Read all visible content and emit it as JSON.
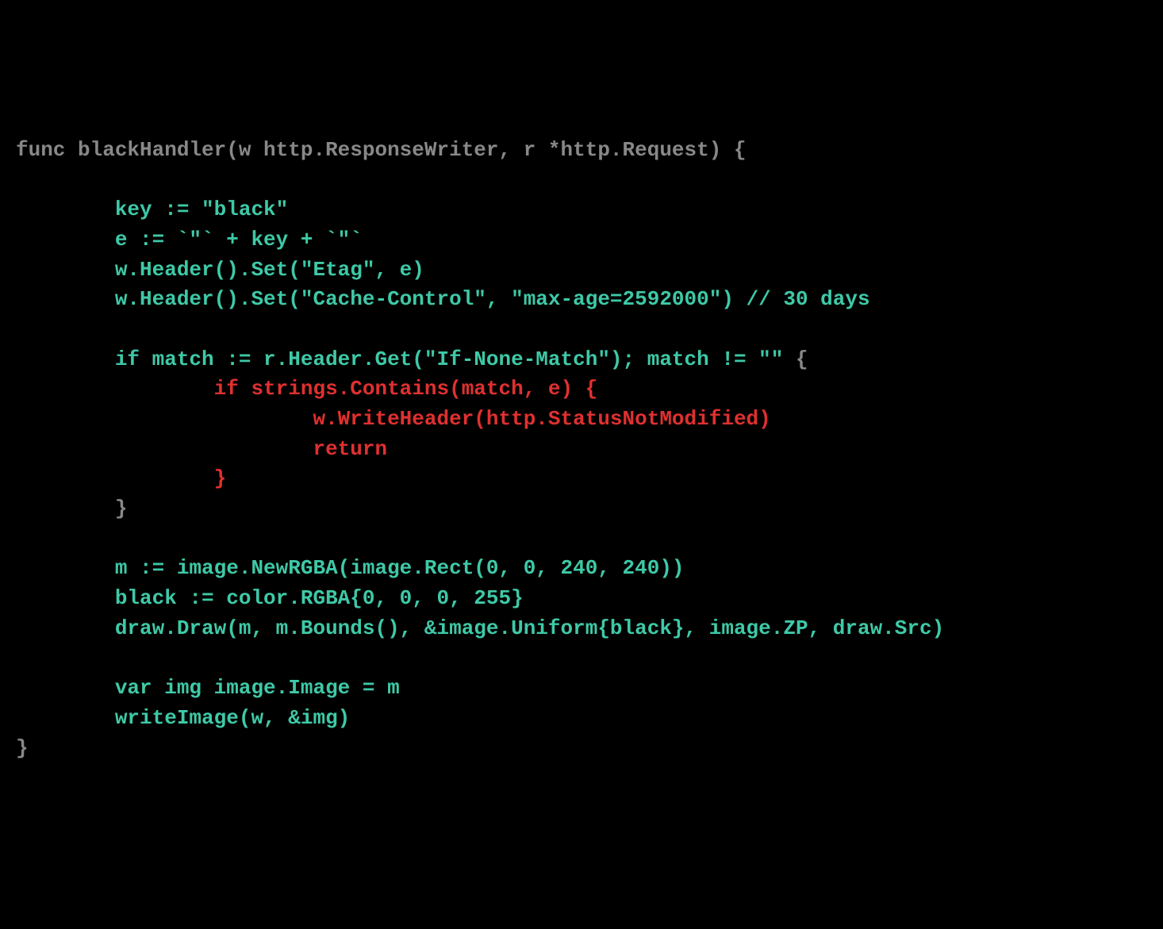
{
  "code": {
    "line1": "func blackHandler(w http.ResponseWriter, r *http.Request) {",
    "line2": "        key := \"black\"",
    "line3": "        e := `\"` + key + `\"`",
    "line4": "        w.Header().Set(\"Etag\", e)",
    "line5": "        w.Header().Set(\"Cache-Control\", \"max-age=2592000\") // 30 days",
    "line6_a": "        if match := r.Header.Get(\"If-None-Match\"); match != \"\" ",
    "line6_b": "{",
    "line7": "                if strings.Contains(match, e) {",
    "line8": "                        w.WriteHeader(http.StatusNotModified)",
    "line9": "                        return",
    "line10": "                }",
    "line11": "        }",
    "line12": "        m := image.NewRGBA(image.Rect(0, 0, 240, 240))",
    "line13": "        black := color.RGBA{0, 0, 0, 255}",
    "line14": "        draw.Draw(m, m.Bounds(), &image.Uniform{black}, image.ZP, draw.Src)",
    "line15": "        var img image.Image = m",
    "line16": "        writeImage(w, &img)",
    "line17": "}"
  }
}
